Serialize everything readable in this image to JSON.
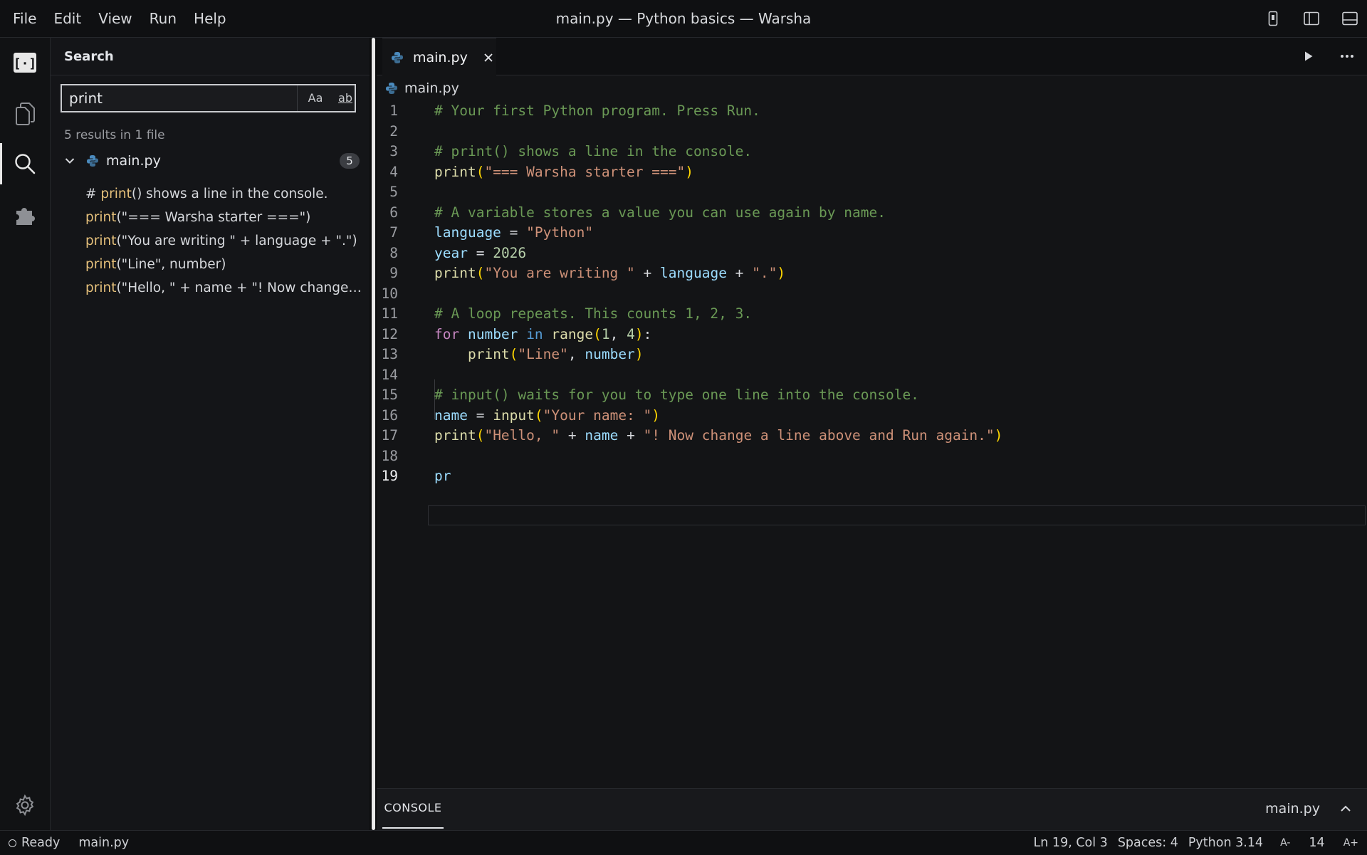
{
  "menu": {
    "items": [
      "File",
      "Edit",
      "View",
      "Run",
      "Help"
    ]
  },
  "window": {
    "title": "main.py — Python basics — Warsha"
  },
  "sidebar": {
    "title": "Search",
    "search": {
      "value": "print",
      "case_label": "Aa",
      "word_label": "ab"
    },
    "summary": "5 results in 1 file",
    "file": {
      "name": "main.py",
      "count": "5"
    },
    "matches": [
      {
        "before": "# ",
        "hit": "print",
        "after": "() shows a line in the console."
      },
      {
        "before": "",
        "hit": "print",
        "after": "(\"=== Warsha starter ===\")"
      },
      {
        "before": "",
        "hit": "print",
        "after": "(\"You are writing \" + language + \".\")"
      },
      {
        "before": "",
        "hit": "print",
        "after": "(\"Line\", number)"
      },
      {
        "before": "",
        "hit": "print",
        "after": "(\"Hello, \" + name + \"! Now change a line above and Run again.\")"
      }
    ]
  },
  "editor": {
    "tab": {
      "label": "main.py"
    },
    "breadcrumb": "main.py",
    "line_numbers": [
      "1",
      "2",
      "3",
      "4",
      "5",
      "6",
      "7",
      "8",
      "9",
      "10",
      "11",
      "12",
      "13",
      "14",
      "15",
      "16",
      "17",
      "18",
      "19"
    ],
    "current_line": "19",
    "code": [
      [
        [
          "c",
          "# Your first Python program. Press Run."
        ]
      ],
      [],
      [
        [
          "c",
          "# print() shows a line in the console."
        ]
      ],
      [
        [
          "f",
          "print"
        ],
        [
          "p",
          "("
        ],
        [
          "s",
          "\"=== Warsha starter ===\""
        ],
        [
          "p",
          ")"
        ]
      ],
      [],
      [
        [
          "c",
          "# A variable stores a value you can use again by name."
        ]
      ],
      [
        [
          "v",
          "language"
        ],
        [
          "o",
          " = "
        ],
        [
          "s",
          "\"Python\""
        ]
      ],
      [
        [
          "v",
          "year"
        ],
        [
          "o",
          " = "
        ],
        [
          "n",
          "2026"
        ]
      ],
      [
        [
          "f",
          "print"
        ],
        [
          "p",
          "("
        ],
        [
          "s",
          "\"You are writing \""
        ],
        [
          "o",
          " + "
        ],
        [
          "v",
          "language"
        ],
        [
          "o",
          " + "
        ],
        [
          "s",
          "\".\""
        ],
        [
          "p",
          ")"
        ]
      ],
      [],
      [
        [
          "c",
          "# A loop repeats. This counts 1, 2, 3."
        ]
      ],
      [
        [
          "k",
          "for"
        ],
        [
          "o",
          " "
        ],
        [
          "v",
          "number"
        ],
        [
          "o",
          " "
        ],
        [
          "b",
          "in"
        ],
        [
          "o",
          " "
        ],
        [
          "f",
          "range"
        ],
        [
          "p",
          "("
        ],
        [
          "n",
          "1"
        ],
        [
          "o",
          ", "
        ],
        [
          "n",
          "4"
        ],
        [
          "p",
          ")"
        ],
        [
          "o",
          ":"
        ]
      ],
      [
        [
          "o",
          "    "
        ],
        [
          "f",
          "print"
        ],
        [
          "p",
          "("
        ],
        [
          "s",
          "\"Line\""
        ],
        [
          "o",
          ", "
        ],
        [
          "v",
          "number"
        ],
        [
          "p",
          ")"
        ]
      ],
      [],
      [
        [
          "c",
          "# input() waits for you to type one line into the console."
        ]
      ],
      [
        [
          "v",
          "name"
        ],
        [
          "o",
          " = "
        ],
        [
          "f",
          "input"
        ],
        [
          "p",
          "("
        ],
        [
          "s",
          "\"Your name: \""
        ],
        [
          "p",
          ")"
        ]
      ],
      [
        [
          "f",
          "print"
        ],
        [
          "p",
          "("
        ],
        [
          "s",
          "\"Hello, \""
        ],
        [
          "o",
          " + "
        ],
        [
          "v",
          "name"
        ],
        [
          "o",
          " + "
        ],
        [
          "s",
          "\"! Now change a line above and Run again.\""
        ],
        [
          "p",
          ")"
        ]
      ],
      [],
      [
        [
          "v",
          "pr"
        ]
      ]
    ]
  },
  "console": {
    "tab_label": "CONSOLE",
    "file": "main.py"
  },
  "status": {
    "state": "Ready",
    "file": "main.py",
    "position": "Ln 19, Col 3",
    "spaces": "Spaces: 4",
    "language": "Python 3.14",
    "font_decrease": "A-",
    "font_size": "14",
    "font_increase": "A+"
  },
  "colors": {
    "comment": "#6a9955",
    "function": "#dcdcaa",
    "string": "#ce9178",
    "variable": "#9cdcfe",
    "keyword": "#c586c0",
    "number": "#b5cea8",
    "highlight": "#e5c07b"
  }
}
